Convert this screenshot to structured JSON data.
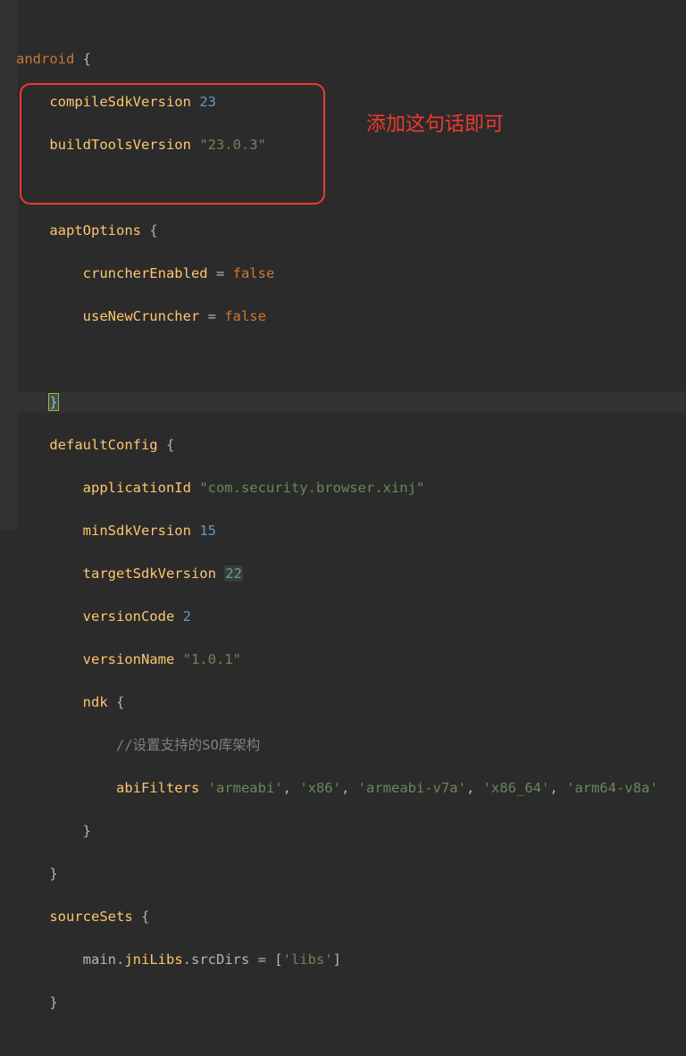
{
  "code": {
    "l0": {
      "kw": "android",
      "brace": " {"
    },
    "l1": {
      "id": "compileSdkVersion ",
      "num": "23"
    },
    "l2": {
      "id": "buildToolsVersion ",
      "str": "\"23.0.3\""
    },
    "l3": "",
    "l4": {
      "id": "aaptOptions ",
      "brace": "{"
    },
    "l5": {
      "id": "cruncherEnabled ",
      "eq": "= ",
      "kw": "false"
    },
    "l6": {
      "id": "useNewCruncher ",
      "eq": "= ",
      "kw": "false"
    },
    "l7": "",
    "l8": {
      "brace": "}"
    },
    "l9": {
      "id": "defaultConfig ",
      "brace": "{"
    },
    "l10": {
      "id": "applicationId ",
      "str": "\"com.security.browser.xinj\""
    },
    "l11": {
      "id": "minSdkVersion ",
      "num": "15"
    },
    "l12": {
      "id": "targetSdkVersion ",
      "num": "22"
    },
    "l13": {
      "id": "versionCode ",
      "num": "2"
    },
    "l14": {
      "id": "versionName ",
      "str": "\"1.0.1\""
    },
    "l15": {
      "id": "ndk ",
      "brace": "{"
    },
    "l16": {
      "cmt": "//设置支持的SO库架构"
    },
    "l17": {
      "id": "abiFilters ",
      "s1": "'armeabi'",
      "c1": ", ",
      "s2": "'x86'",
      "c2": ", ",
      "s3": "'armeabi-v7a'",
      "c3": ", ",
      "s4": "'x86_64'",
      "c4": ", ",
      "s5": "'arm64-v8a'"
    },
    "l18": {
      "brace": "}"
    },
    "l19": {
      "brace": "}"
    },
    "l20": {
      "id": "sourceSets ",
      "brace": "{"
    },
    "l21": {
      "p1": "main.",
      "id": "jniLibs",
      "p2": ".srcDirs = [",
      "str": "'libs'",
      "p3": "]"
    },
    "l22": {
      "brace": "}"
    }
  },
  "annotation_text": "添加这句话即可"
}
